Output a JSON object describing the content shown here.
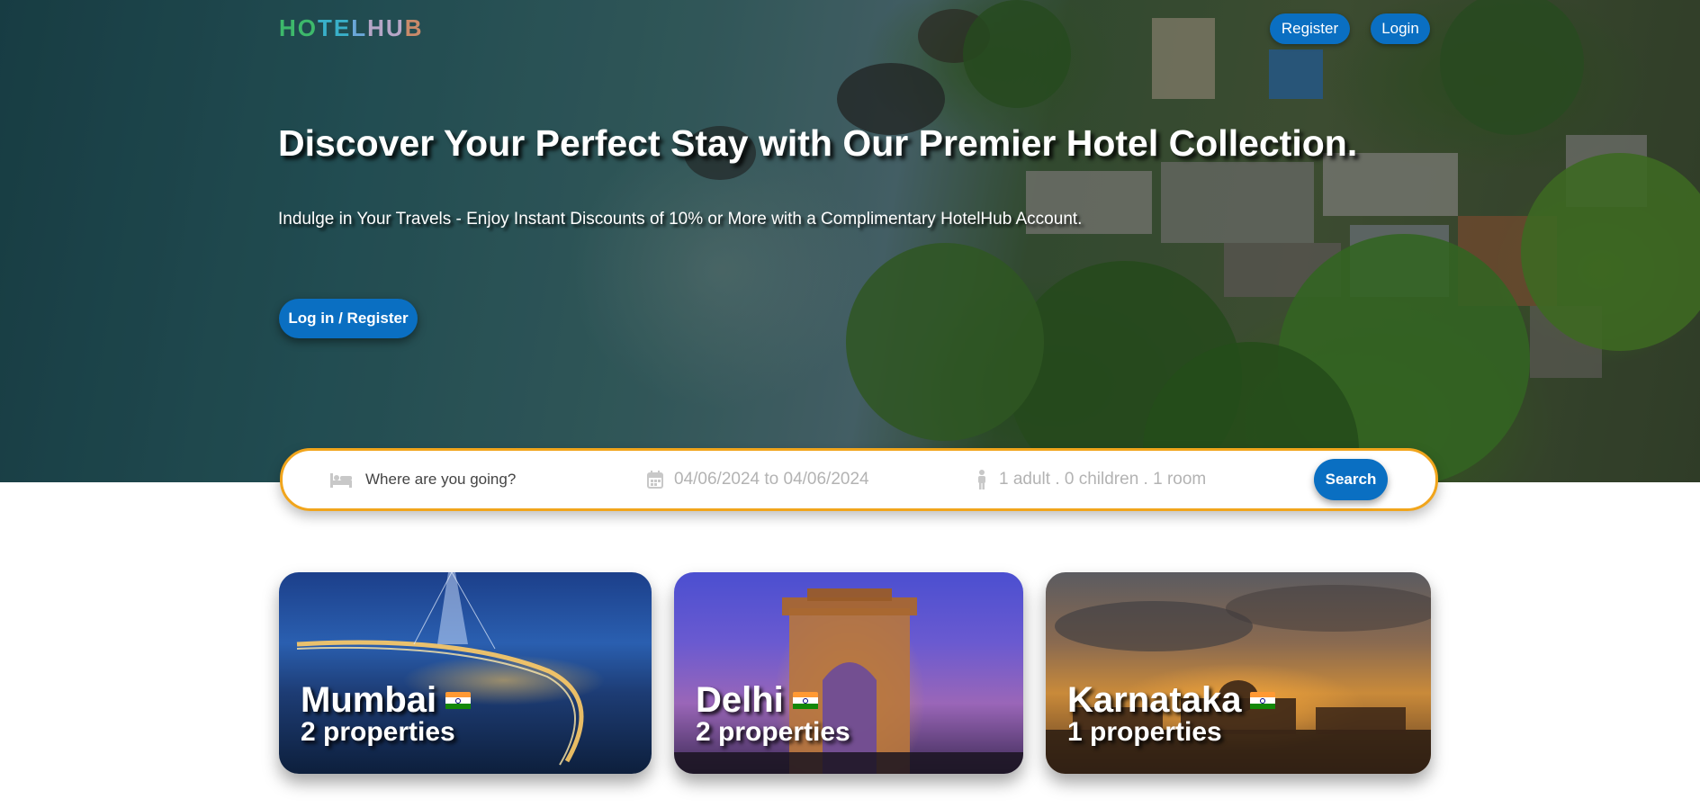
{
  "header": {
    "logo": [
      "H",
      "O",
      "T",
      "E",
      "L",
      "H",
      "U",
      "B"
    ],
    "register_label": "Register",
    "login_label": "Login"
  },
  "hero": {
    "title": "Discover Your Perfect Stay with Our Premier Hotel Collection.",
    "subtitle": "Indulge in Your Travels - Enjoy Instant Discounts of 10% or More with a Complimentary HotelHub Account.",
    "cta_label": "Log in / Register"
  },
  "search": {
    "destination_placeholder": "Where are you going?",
    "dates_text": "04/06/2024 to 04/06/2024",
    "guests_text": "1 adult . 0 children . 1 room",
    "search_label": "Search",
    "icons": [
      "bed-icon",
      "calendar-icon",
      "person-icon"
    ],
    "accent_color": "#f1a51c",
    "button_color": "#0a6fc2"
  },
  "cities": [
    {
      "name": "Mumbai",
      "properties": "2 properties",
      "flag": "india-flag-icon"
    },
    {
      "name": "Delhi",
      "properties": "2 properties",
      "flag": "india-flag-icon"
    },
    {
      "name": "Karnataka",
      "properties": "1 properties",
      "flag": "india-flag-icon"
    }
  ]
}
